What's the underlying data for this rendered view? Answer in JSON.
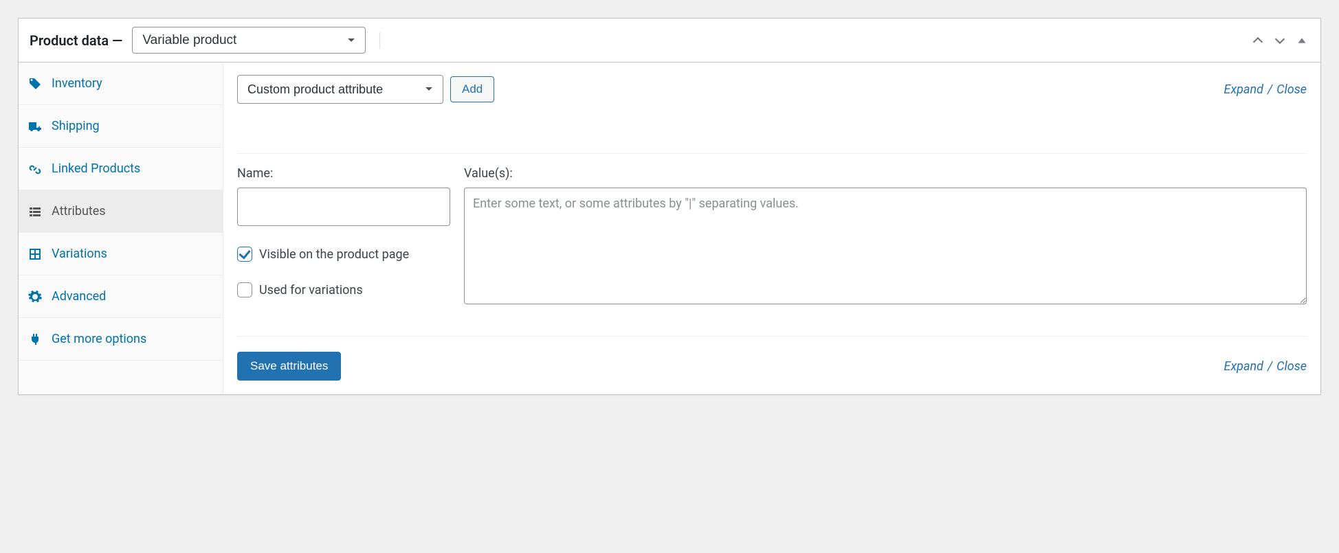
{
  "header": {
    "title": "Product data —",
    "product_type": "Variable product"
  },
  "tabs": [
    {
      "id": "inventory",
      "label": "Inventory",
      "icon": "inventory",
      "active": false
    },
    {
      "id": "shipping",
      "label": "Shipping",
      "icon": "shipping",
      "active": false
    },
    {
      "id": "linked",
      "label": "Linked Products",
      "icon": "link",
      "active": false
    },
    {
      "id": "attributes",
      "label": "Attributes",
      "icon": "list",
      "active": true
    },
    {
      "id": "variations",
      "label": "Variations",
      "icon": "grid",
      "active": false
    },
    {
      "id": "advanced",
      "label": "Advanced",
      "icon": "gear",
      "active": false
    },
    {
      "id": "getmore",
      "label": "Get more options",
      "icon": "plug",
      "active": false
    }
  ],
  "toolbar": {
    "attribute_select": "Custom product attribute",
    "add_label": "Add",
    "expand_label": "Expand",
    "close_label": "Close"
  },
  "form": {
    "name_label": "Name:",
    "name_value": "",
    "values_label": "Value(s):",
    "values_value": "",
    "values_placeholder": "Enter some text, or some attributes by \"|\" separating values.",
    "visible_label": "Visible on the product page",
    "visible_checked": true,
    "variations_label": "Used for variations",
    "variations_checked": false
  },
  "footer": {
    "save_label": "Save attributes",
    "expand_label": "Expand",
    "close_label": "Close"
  }
}
